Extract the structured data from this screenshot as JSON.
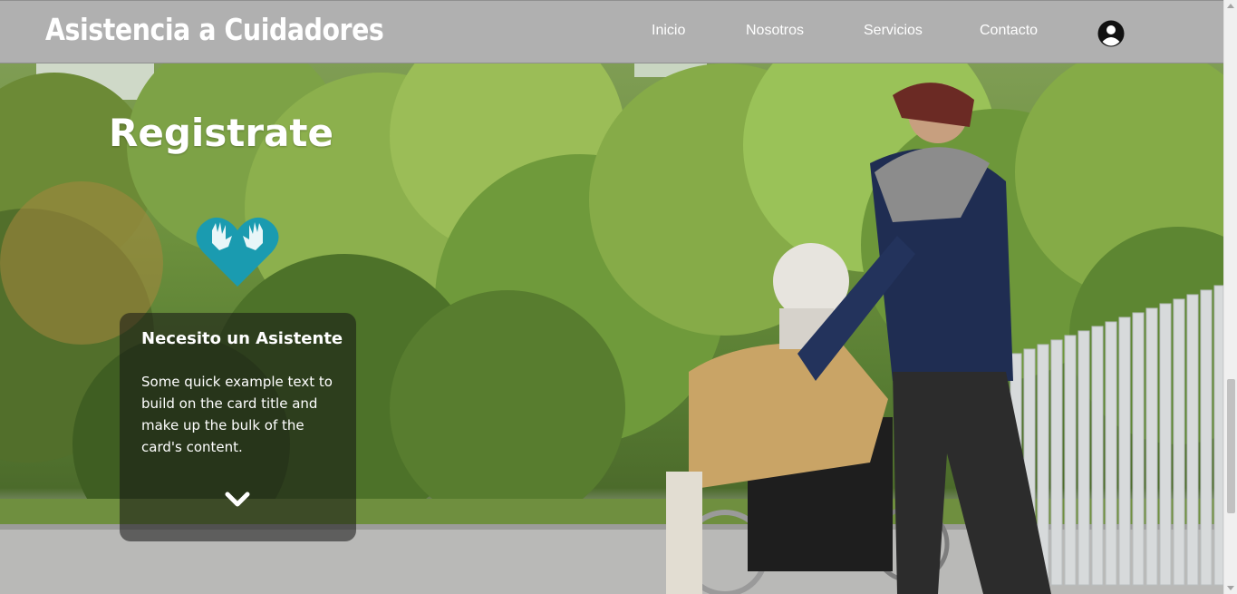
{
  "navbar": {
    "brand": "Asistencia a Cuidadores",
    "links": [
      {
        "label": "Inicio"
      },
      {
        "label": "Nosotros"
      },
      {
        "label": "Servicios"
      },
      {
        "label": "Contacto"
      }
    ],
    "user_icon": "user-circle-icon"
  },
  "hero": {
    "title": "Registrate",
    "icon": "heart-hands-icon",
    "icon_color": "#1a9bb0"
  },
  "card": {
    "title": "Necesito un Asistente",
    "text": "Some quick example text to build on the card title and make up the bulk of the card's content.",
    "toggle_icon": "chevron-down-icon"
  },
  "colors": {
    "navbar_bg": "#b0b0b0",
    "accent": "#1a9bb0",
    "card_bg": "rgba(20,20,20,0.55)"
  }
}
